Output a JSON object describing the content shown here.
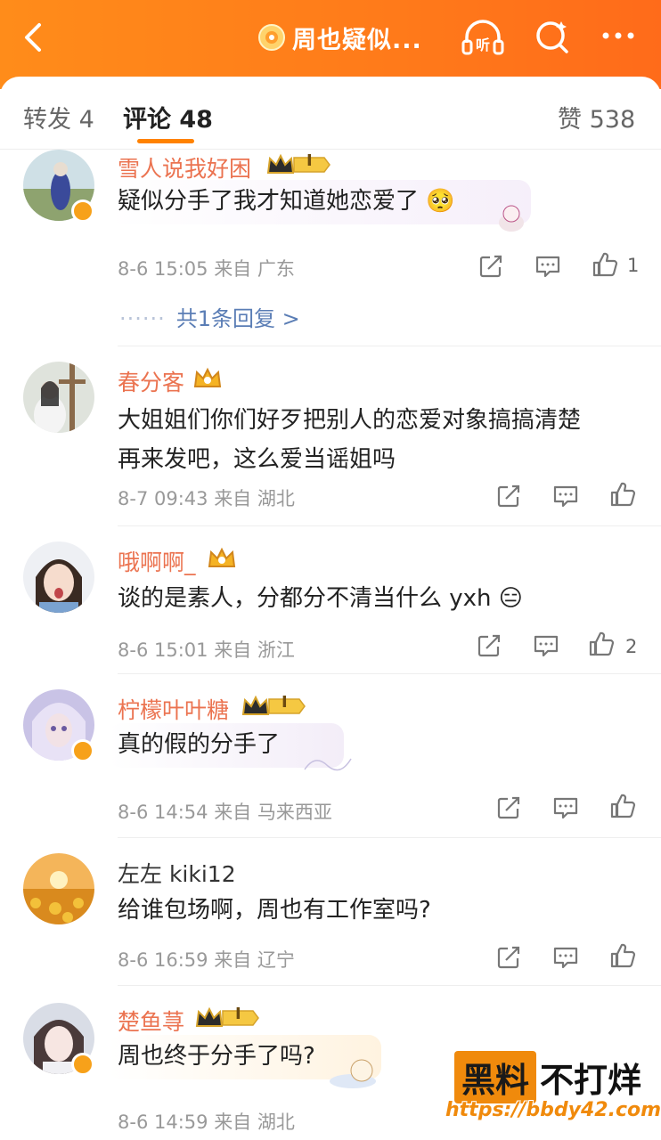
{
  "header": {
    "title": "周也疑似...",
    "title_badge_icon": "super-topic-badge-icon",
    "listen_label": "听",
    "colors": {
      "bar": "#ff7a1a",
      "accent": "#ff8200",
      "username": "#eb7350"
    }
  },
  "tabs": {
    "repost": "转发 4",
    "comments": "评论 48",
    "likes": "赞 538"
  },
  "comments": [
    {
      "user": "雪人说我好困",
      "vip": true,
      "crown_label": "I",
      "text": "疑似分手了我才知道她恋爱了",
      "emoji": "🥺",
      "time": "8-6 15:05",
      "location": "来自 广东",
      "likes": "1",
      "replies": "共1条回复 >"
    },
    {
      "user": "春分客",
      "vip": true,
      "crown_label": "",
      "text_line1": "大姐姐们你们好歹把别人的恋爱对象搞搞清楚",
      "text_line2": "再来发吧，这么爱当谣姐吗",
      "time": "8-7 09:43",
      "location": "来自 湖北",
      "likes": ""
    },
    {
      "user": "哦啊啊_",
      "vip": true,
      "crown_label": "",
      "text": "谈的是素人，分都分不清当什么 yxh",
      "emoji": "😑",
      "time": "8-6 15:01",
      "location": "来自 浙江",
      "likes": "2"
    },
    {
      "user": "柠檬叶叶糖",
      "vip": true,
      "crown_label": "I",
      "text": "真的假的分手了",
      "time": "8-6 14:54",
      "location": "来自 马来西亚",
      "likes": ""
    },
    {
      "user": "左左 kiki12",
      "vip": false,
      "text": "给谁包场啊，周也有工作室吗?",
      "time": "8-6 16:59",
      "location": "来自 辽宁",
      "likes": ""
    },
    {
      "user": "楚鱼荨",
      "vip": true,
      "crown_label": "I",
      "text": "周也终于分手了吗?",
      "time": "8-6 14:59",
      "location": "来自 湖北",
      "likes": ""
    }
  ],
  "watermark": {
    "part1": "黑料",
    "part2": "不打烊",
    "url": "https://bbdy42.com"
  }
}
